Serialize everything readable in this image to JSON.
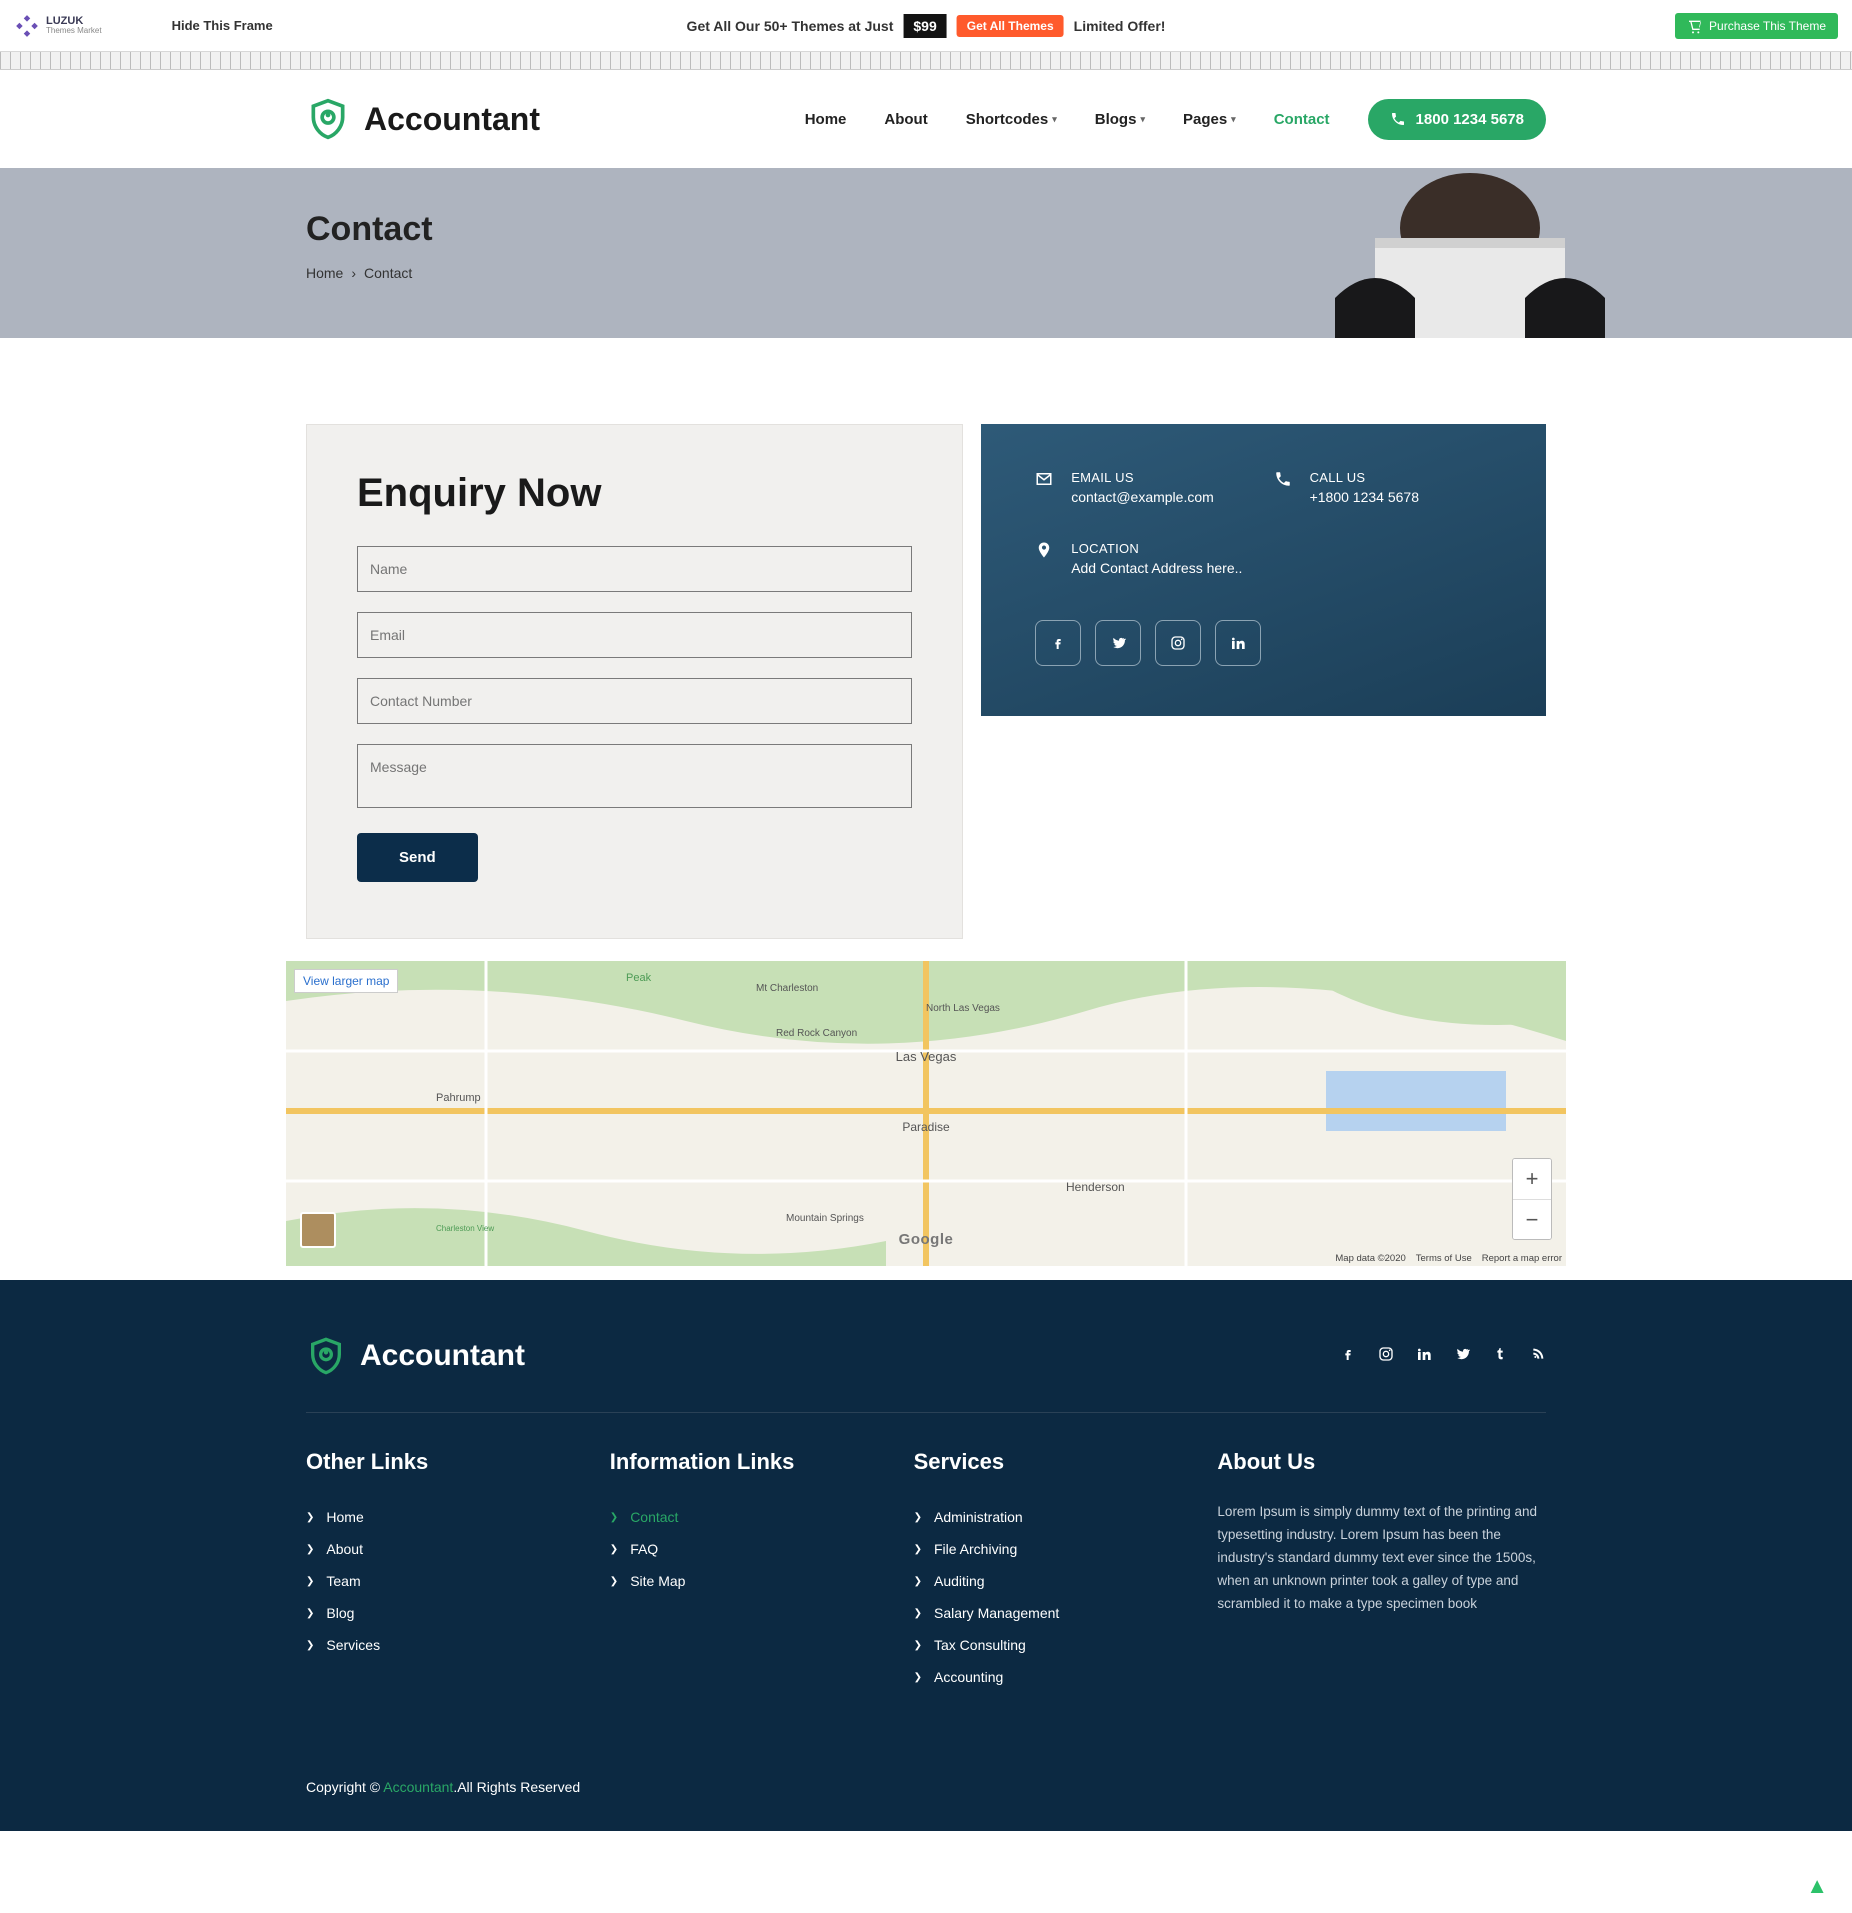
{
  "promo": {
    "logo_main": "LUZUK",
    "logo_sub": "Themes Market",
    "hide_frame": "Hide This Frame",
    "text_left": "Get All Our 50+ Themes at Just",
    "price": "$99",
    "get_all": "Get All Themes",
    "text_right": "Limited Offer!",
    "purchase": "Purchase This Theme"
  },
  "header": {
    "brand": "Accountant",
    "nav": {
      "home": "Home",
      "about": "About",
      "shortcodes": "Shortcodes",
      "blogs": "Blogs",
      "pages": "Pages",
      "contact": "Contact"
    },
    "phone": "1800 1234 5678"
  },
  "hero": {
    "title": "Contact",
    "crumb_home": "Home",
    "crumb_current": "Contact"
  },
  "enquiry": {
    "title": "Enquiry Now",
    "name_ph": "Name",
    "email_ph": "Email",
    "phone_ph": "Contact Number",
    "message_ph": "Message",
    "send": "Send"
  },
  "contact": {
    "email_label": "EMAIL US",
    "email_val": "contact@example.com",
    "call_label": "CALL US",
    "call_val": "+1800 1234 5678",
    "loc_label": "LOCATION",
    "loc_val": "Add Contact Address here.."
  },
  "map": {
    "view_larger": "View larger map",
    "credit_data": "Map data ©2020",
    "credit_terms": "Terms of Use",
    "credit_report": "Report a map error",
    "google": "Google"
  },
  "footer": {
    "brand": "Accountant",
    "col1_title": "Other Links",
    "col1": {
      "a": "Home",
      "b": "About",
      "c": "Team",
      "d": "Blog",
      "e": "Services"
    },
    "col2_title": "Information Links",
    "col2": {
      "a": "Contact",
      "b": "FAQ",
      "c": "Site Map"
    },
    "col3_title": "Services",
    "col3": {
      "a": "Administration",
      "b": "File Archiving",
      "c": "Auditing",
      "d": "Salary Management",
      "e": "Tax Consulting",
      "f": "Accounting"
    },
    "col4_title": "About Us",
    "about_text": "Lorem Ipsum is simply dummy text of the printing and typesetting industry. Lorem Ipsum has been the industry's standard dummy text ever since the 1500s, when an unknown printer took a galley of type and scrambled it to make a type specimen book",
    "copyright_prefix": "Copyright © ",
    "copyright_link": "Accountant",
    "copyright_suffix": ".All Rights Reserved"
  }
}
